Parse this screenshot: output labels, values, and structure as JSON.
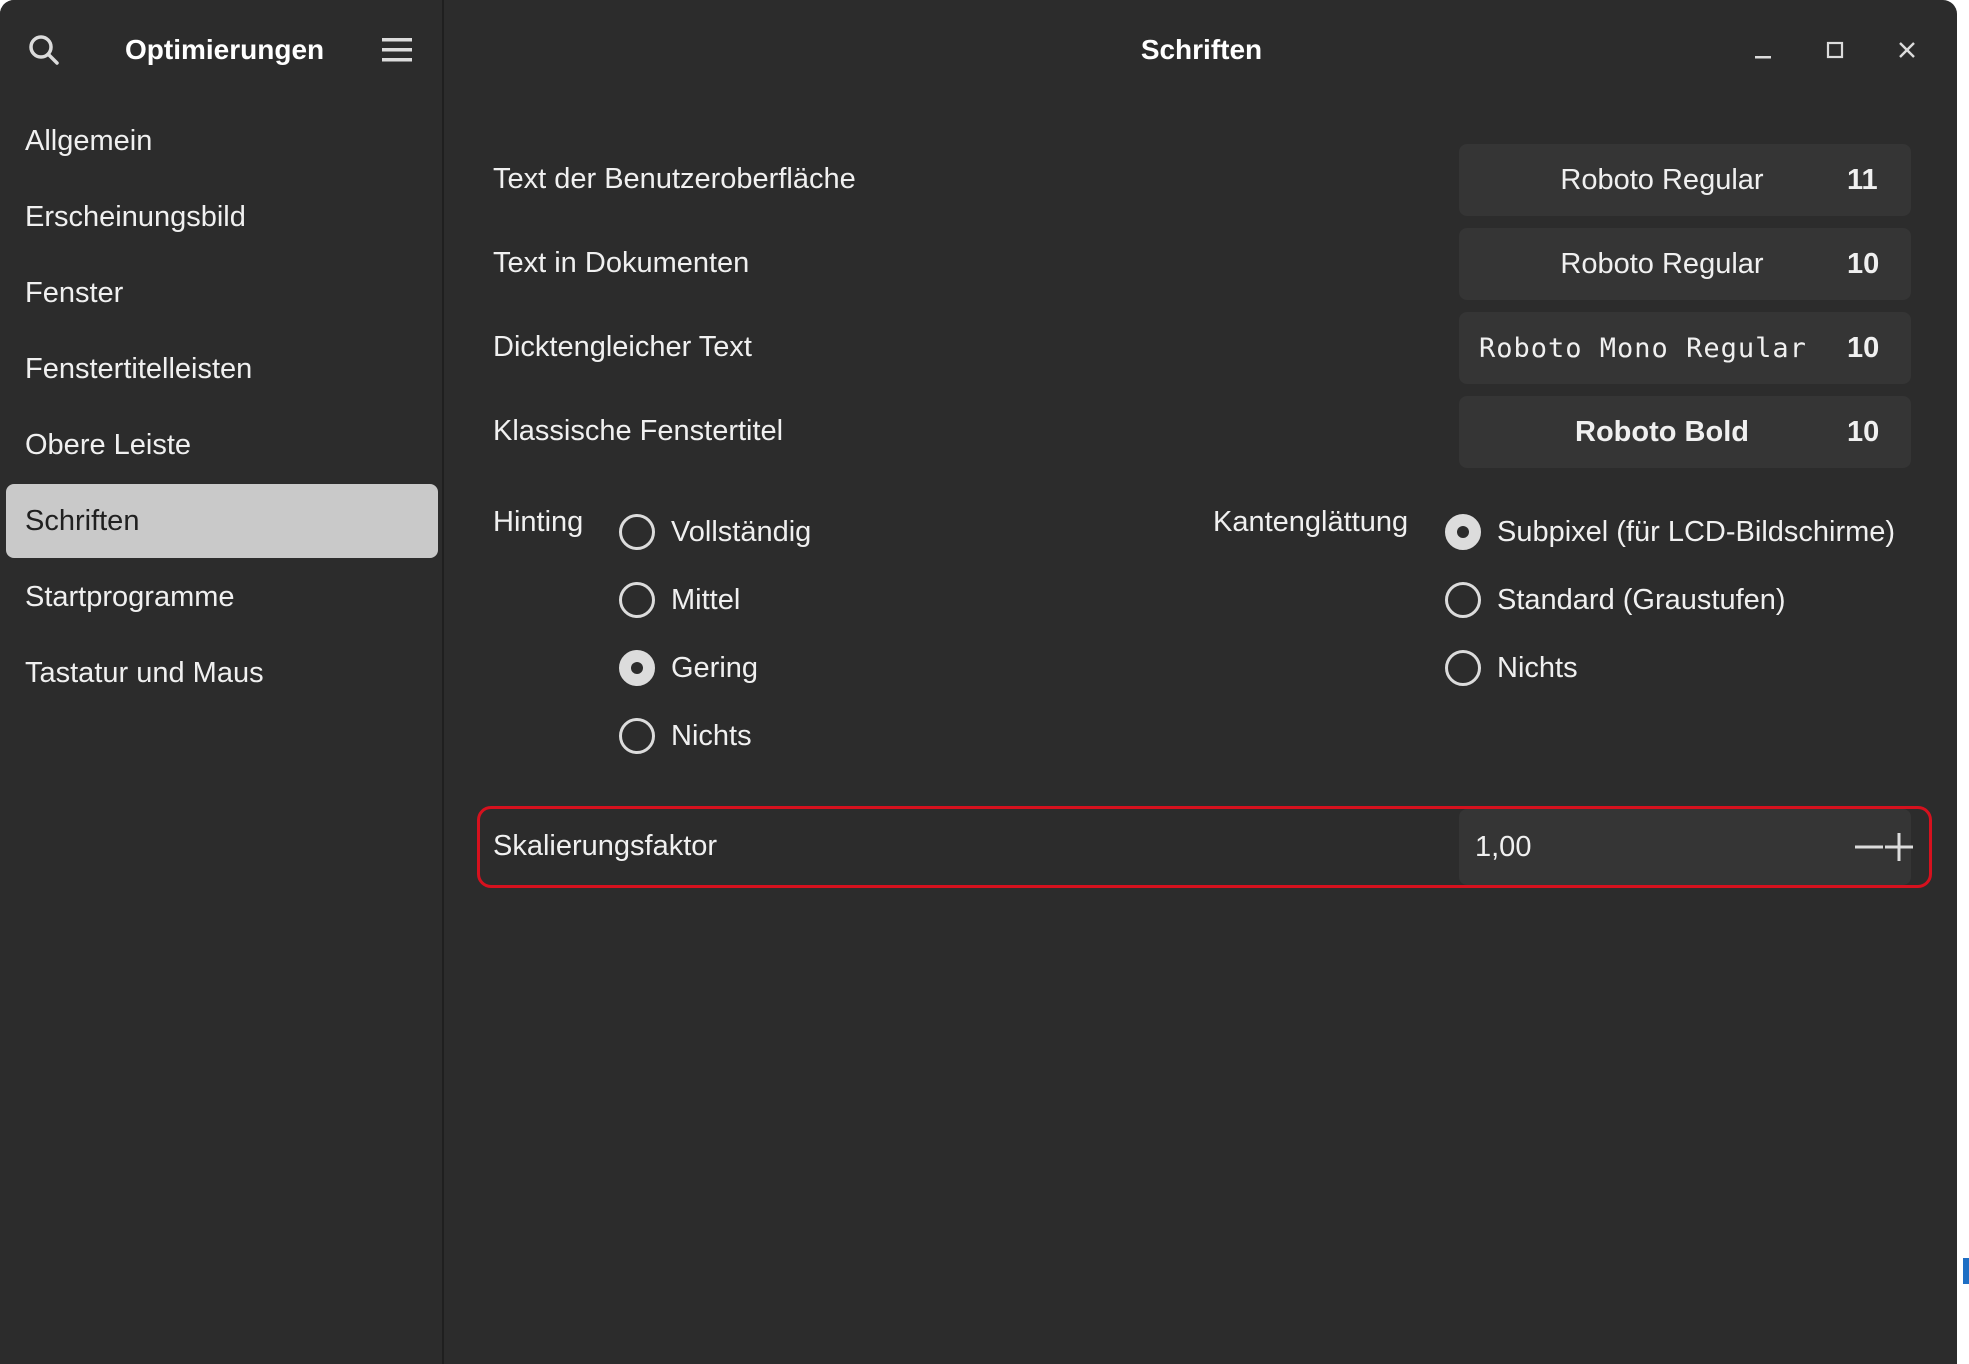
{
  "sidebar": {
    "title": "Optimierungen",
    "search_icon": "search-icon",
    "menu_icon": "hamburger-menu-icon",
    "items": [
      {
        "label": "Allgemein"
      },
      {
        "label": "Erscheinungsbild"
      },
      {
        "label": "Fenster"
      },
      {
        "label": "Fenstertitelleisten"
      },
      {
        "label": "Obere Leiste"
      },
      {
        "label": "Schriften",
        "active": true
      },
      {
        "label": "Startprogramme"
      },
      {
        "label": "Tastatur und Maus"
      }
    ]
  },
  "header": {
    "title": "Schriften",
    "controls": [
      "minimize-icon",
      "maximize-icon",
      "close-icon"
    ]
  },
  "fonts": [
    {
      "label": "Text der Benutzeroberfläche",
      "font": "Roboto Regular",
      "size": "11"
    },
    {
      "label": "Text in Dokumenten",
      "font": "Roboto Regular",
      "size": "10"
    },
    {
      "label": "Dicktengleicher Text",
      "font": "Roboto Mono Regular",
      "size": "10"
    },
    {
      "label": "Klassische Fenstertitel",
      "font": "Roboto Bold",
      "size": "10"
    }
  ],
  "hinting": {
    "label": "Hinting",
    "options": [
      "Vollständig",
      "Mittel",
      "Gering",
      "Nichts"
    ],
    "selected": "Gering"
  },
  "antialiasing": {
    "label": "Kantenglättung",
    "options": [
      "Subpixel (für LCD-Bildschirme)",
      "Standard (Graustufen)",
      "Nichts"
    ],
    "selected": "Subpixel (für LCD-Bildschirme)"
  },
  "scaling": {
    "label": "Skalierungsfaktor",
    "value": "1,00",
    "minus_icon": "minus-icon",
    "plus_icon": "plus-icon"
  },
  "colors": {
    "background": "#2c2c2c",
    "active_nav": "#c9c9c9",
    "button_bg": "#353535",
    "highlight": "#d6111e"
  }
}
